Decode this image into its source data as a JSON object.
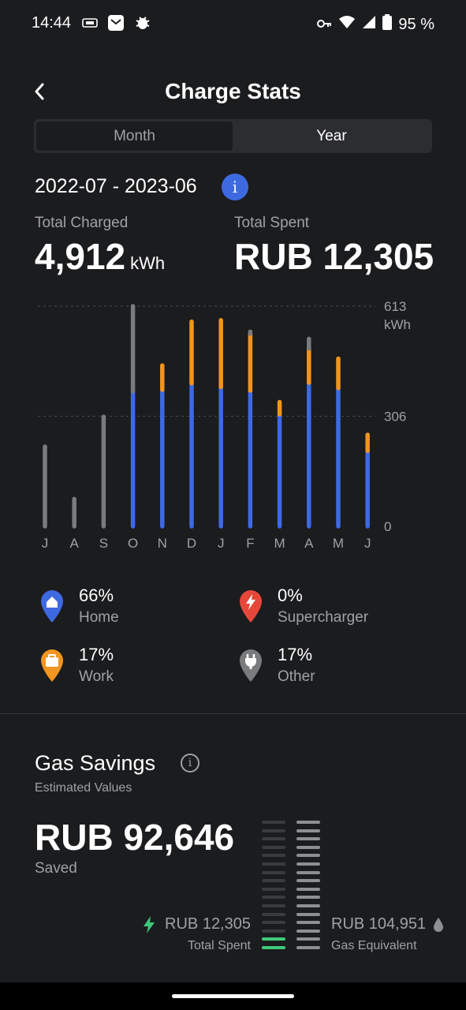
{
  "status": {
    "time": "14:44",
    "battery": "95 %",
    "left_icons": [
      "sim-icon",
      "mail-icon",
      "bug-icon"
    ],
    "right_icons": [
      "key-icon",
      "wifi-icon",
      "signal-icon",
      "battery-icon"
    ]
  },
  "header": {
    "title": "Charge Stats",
    "back_icon": "chevron-left-icon"
  },
  "tabs": [
    {
      "label": "Month",
      "selected": false
    },
    {
      "label": "Year",
      "selected": true
    }
  ],
  "period": "2022-07 - 2023-06",
  "totals": {
    "charged_label": "Total Charged",
    "charged_value": "4,912",
    "charged_unit": "kWh",
    "spent_label": "Total Spent",
    "spent_value": "RUB 12,305"
  },
  "chart_data": {
    "type": "bar",
    "stacked": true,
    "categories": [
      "J",
      "A",
      "S",
      "O",
      "N",
      "D",
      "J",
      "F",
      "M",
      "A",
      "M",
      "J"
    ],
    "series": [
      {
        "name": "Home",
        "color": "#3e6ae1",
        "values": [
          0,
          0,
          0,
          376,
          380,
          398,
          388,
          378,
          312,
          400,
          385,
          210
        ]
      },
      {
        "name": "Work",
        "color": "#f0951f",
        "values": [
          0,
          0,
          0,
          0,
          68,
          172,
          186,
          158,
          34,
          95,
          82,
          45
        ]
      },
      {
        "name": "Other",
        "color": "#7a7b7d",
        "values": [
          222,
          76,
          305,
          237,
          0,
          0,
          0,
          6,
          0,
          27,
          0,
          0
        ]
      }
    ],
    "yticks": [
      "0",
      "306",
      "613"
    ],
    "y_unit": "kWh",
    "ylim": [
      0,
      613
    ],
    "grid": true
  },
  "legend": [
    {
      "pct": "66%",
      "label": "Home",
      "color": "#3e6ae1",
      "icon": "home-pin-icon"
    },
    {
      "pct": "0%",
      "label": "Supercharger",
      "color": "#e6473b",
      "icon": "supercharger-pin-icon"
    },
    {
      "pct": "17%",
      "label": "Work",
      "color": "#f0951f",
      "icon": "work-pin-icon"
    },
    {
      "pct": "17%",
      "label": "Other",
      "color": "#7a7b7d",
      "icon": "plug-pin-icon"
    }
  ],
  "gas": {
    "title": "Gas Savings",
    "subtitle": "Estimated Values",
    "amount": "RUB 92,646",
    "saved_label": "Saved",
    "spent_value": "RUB 12,305",
    "spent_label": "Total Spent",
    "equiv_value": "RUB 104,951",
    "equiv_label": "Gas Equivalent",
    "spent_fraction": 0.117,
    "colors": {
      "spent": "#3ec97a",
      "dim": "#3a3b3d",
      "equiv": "#8e8f91"
    }
  }
}
